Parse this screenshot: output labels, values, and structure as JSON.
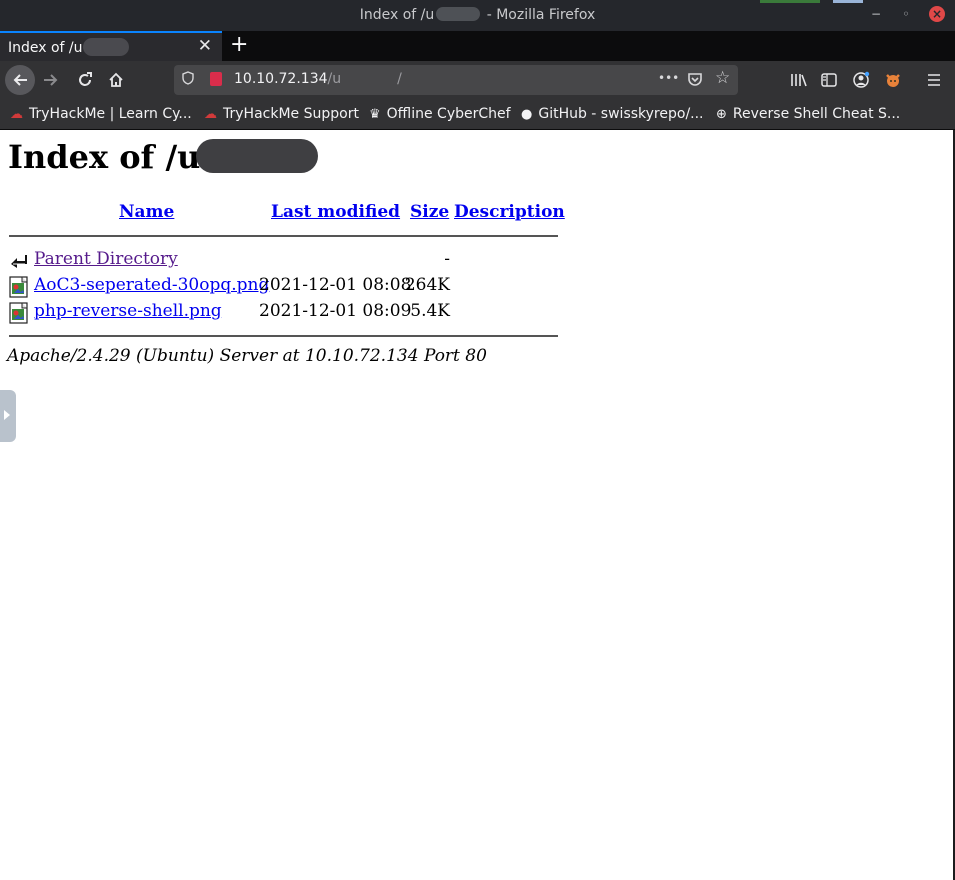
{
  "window": {
    "title_prefix": "Index of /u",
    "title_suffix": " - Mozilla Firefox"
  },
  "tab": {
    "label_prefix": "Index of /u",
    "close": "✕",
    "new_tab": "+"
  },
  "navbar": {
    "url_host": "10.10.72.134",
    "url_path": "/u",
    "url_trail": "/",
    "more": "•••"
  },
  "bookmarks": [
    {
      "label": "TryHackMe | Learn Cy...",
      "icon": "cloud-icon"
    },
    {
      "label": "TryHackMe Support",
      "icon": "cloud-icon"
    },
    {
      "label": "Offline CyberChef",
      "icon": "chef-hat-icon"
    },
    {
      "label": "GitHub - swisskyrepo/...",
      "icon": "github-icon"
    },
    {
      "label": "Reverse Shell Cheat S...",
      "icon": "globe-icon"
    }
  ],
  "page": {
    "heading_prefix": "Index of /u",
    "columns": {
      "name": "Name",
      "last_modified": "Last modified",
      "size": "Size",
      "description": "Description"
    },
    "rows": [
      {
        "name": "Parent Directory",
        "date": "",
        "size": "-",
        "icon": "back-arrow-icon"
      },
      {
        "name": "AoC3-seperated-30opq.png",
        "date": "2021-12-01 08:08",
        "size": "264K",
        "icon": "image-file-icon"
      },
      {
        "name": "php-reverse-shell.png",
        "date": "2021-12-01 08:09",
        "size": "5.4K",
        "icon": "image-file-icon"
      }
    ],
    "footer": "Apache/2.4.29 (Ubuntu) Server at 10.10.72.134 Port 80"
  },
  "colors": {
    "link": "#0000ee",
    "visited": "#551a8b",
    "tab_accent": "#0a84ff",
    "close_button": "#e04848"
  }
}
